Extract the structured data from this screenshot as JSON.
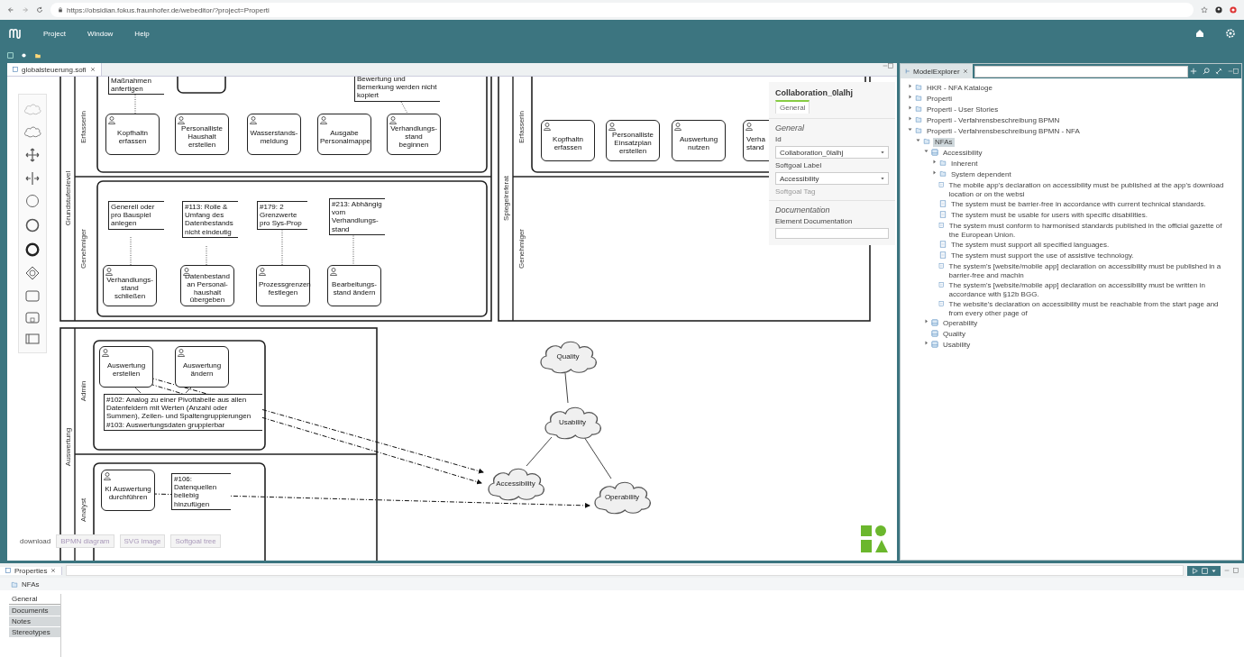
{
  "browser": {
    "url": "https://obsidian.fokus.fraunhofer.de/webeditor/?project=Properti"
  },
  "menu": [
    {
      "label": "Project"
    },
    {
      "label": "Window"
    },
    {
      "label": "Help"
    }
  ],
  "editor": {
    "tab": {
      "label": "globalsteuerung.sofi",
      "selected": true
    }
  },
  "palette": [
    {
      "kind": "cloud-faint"
    },
    {
      "kind": "cloud"
    },
    {
      "kind": "move"
    },
    {
      "kind": "space"
    },
    {
      "kind": "start"
    },
    {
      "kind": "intermediate"
    },
    {
      "kind": "end"
    },
    {
      "kind": "gateway"
    },
    {
      "kind": "task"
    },
    {
      "kind": "subprocess"
    },
    {
      "kind": "pool"
    }
  ],
  "diagram": {
    "pools": [
      {
        "label": "Grundstufenlevel",
        "lanes": [
          "Erfasserin",
          "Genehmiger"
        ]
      },
      {
        "label": "Spiegelreferat",
        "lanes": [
          "Erfasserin",
          "Genehmiger"
        ]
      },
      {
        "label": "Auswertung",
        "lanes": [
          "Admin",
          "Analyst"
        ]
      }
    ],
    "tasks": [
      {
        "label": "Kopfhaltn erfassen"
      },
      {
        "label": "Personalliste Haushalt erstellen"
      },
      {
        "label": "Wasserstands-meldung"
      },
      {
        "label": "Ausgabe Personalmappe"
      },
      {
        "label": "Verhandlungs-stand beginnen"
      },
      {
        "label": "Verhandlungs-stand schließen"
      },
      {
        "label": "Datenbestand an Personal-haushalt übergeben"
      },
      {
        "label": "Prozessgrenzen festlegen"
      },
      {
        "label": "Bearbeitungs-stand ändern"
      },
      {
        "label": "Kopfhaltn erfassen"
      },
      {
        "label": "Personalliste Einsatzplan erstellen"
      },
      {
        "label": "Auswertung nutzen"
      },
      {
        "label": "Verha\nstand"
      },
      {
        "label": "Auswertung erstellen"
      },
      {
        "label": "Auswertung ändern"
      },
      {
        "label": "KI Auswertung durchführen"
      }
    ],
    "annotations": [
      {
        "text": "Maßnahmen anfertigen"
      },
      {
        "text": "Bewertung und Bemerkung werden nicht kopiert"
      },
      {
        "text": "Generell oder pro Bauspiel anlegen"
      },
      {
        "text": "#113: Rolle & Umfang des Datenbestands nicht eindeutig"
      },
      {
        "text": "#179: 2 Grenzwerte pro Sys-Prop"
      },
      {
        "text": "#213: Abhängig vom Verhandlungs-stand"
      },
      {
        "text": "#102: Analog zu einer Pivottabelle aus allen Datenfeldern mit Werten (Anzahl oder Summen), Zeilen- und Spaltengruppierungen\n#103: Auswertungsdaten gruppierbar"
      },
      {
        "text": "#106: Datenquellen beliebig hinzufügen"
      }
    ],
    "softgoals": [
      {
        "label": "Quality"
      },
      {
        "label": "Usability"
      },
      {
        "label": "Accessibility"
      },
      {
        "label": "Operability"
      }
    ]
  },
  "download": {
    "label": "download",
    "buttons": [
      "BPMN diagram",
      "SVG image",
      "Softgoal tree"
    ]
  },
  "properties": {
    "title": "Collaboration_0lalhj",
    "tab": {
      "label": "General",
      "selected": true
    },
    "section": "General",
    "id_label": "Id",
    "id_value": "Collaboration_0lalhj",
    "softgoal_label": "Softgoal Label",
    "softgoal_value": "Accessibility",
    "softgoal_tag": "Softgoal Tag",
    "doc_section": "Documentation",
    "doc_label": "Element Documentation"
  },
  "model_explorer": {
    "tab": {
      "label": "ModelExplorer",
      "selected": true
    },
    "tree": [
      {
        "label": "HKR - NFA Kataloge",
        "kind": "folder",
        "expanded": false,
        "selected": false
      },
      {
        "label": "Properti",
        "kind": "folder",
        "expanded": false,
        "selected": false
      },
      {
        "label": "Properti - User Stories",
        "kind": "folder",
        "expanded": false,
        "selected": false
      },
      {
        "label": "Properti - Verfahrensbeschreibung BPMN",
        "kind": "folder",
        "expanded": false,
        "selected": false
      },
      {
        "label": "Properti - Verfahrensbeschreibung BPMN - NFA",
        "kind": "folder",
        "expanded": true,
        "selected": false,
        "children": [
          {
            "label": "NFAs",
            "kind": "folder",
            "expanded": true,
            "selected": true,
            "children": [
              {
                "label": "Accessibility",
                "kind": "softgoal",
                "expanded": true,
                "selected": false,
                "children": [
                  {
                    "label": "Inherent",
                    "kind": "folder",
                    "expanded": false,
                    "selected": false
                  },
                  {
                    "label": "System dependent",
                    "kind": "folder",
                    "expanded": false,
                    "selected": false
                  },
                  {
                    "label": "The mobile app's declaration on accessibility must be published at the app's download location or on the websi",
                    "kind": "requirement",
                    "selected": false
                  },
                  {
                    "label": "The system must be barrier-free in accordance with current technical standards.",
                    "kind": "requirement",
                    "selected": false
                  },
                  {
                    "label": "The system must be usable for users with specific disabilities.",
                    "kind": "requirement",
                    "selected": false
                  },
                  {
                    "label": "The system must conform to harmonised standards published in the official gazette of the European Union.",
                    "kind": "requirement",
                    "selected": false
                  },
                  {
                    "label": "The system must support all specified languages.",
                    "kind": "requirement",
                    "selected": false
                  },
                  {
                    "label": "The system must support the use of assistive technology.",
                    "kind": "requirement",
                    "selected": false
                  },
                  {
                    "label": "The system's [website/mobile app] declaration on accessibility must be published in a barrier-free and machin",
                    "kind": "requirement",
                    "selected": false
                  },
                  {
                    "label": "The system's [website/mobile app] declaration on accessibility must be written in accordance with §12b BGG.",
                    "kind": "requirement",
                    "selected": false
                  },
                  {
                    "label": "The website's declaration on accessibility must be reachable from the start page and from every other page of",
                    "kind": "requirement",
                    "selected": false
                  }
                ]
              },
              {
                "label": "Operability",
                "kind": "softgoal",
                "expanded": false,
                "selected": false
              },
              {
                "label": "Quality",
                "kind": "softgoal",
                "selected": false
              },
              {
                "label": "Usability",
                "kind": "softgoal",
                "expanded": false,
                "selected": false
              }
            ]
          }
        ]
      }
    ]
  },
  "bottom_panel": {
    "tab": {
      "label": "Properties",
      "selected": true
    },
    "element": "NFAs",
    "tabs": [
      {
        "label": "General",
        "selected": true
      },
      {
        "label": "Documents",
        "selected": false
      },
      {
        "label": "Notes",
        "selected": false
      },
      {
        "label": "Stereotypes",
        "selected": false
      }
    ]
  }
}
